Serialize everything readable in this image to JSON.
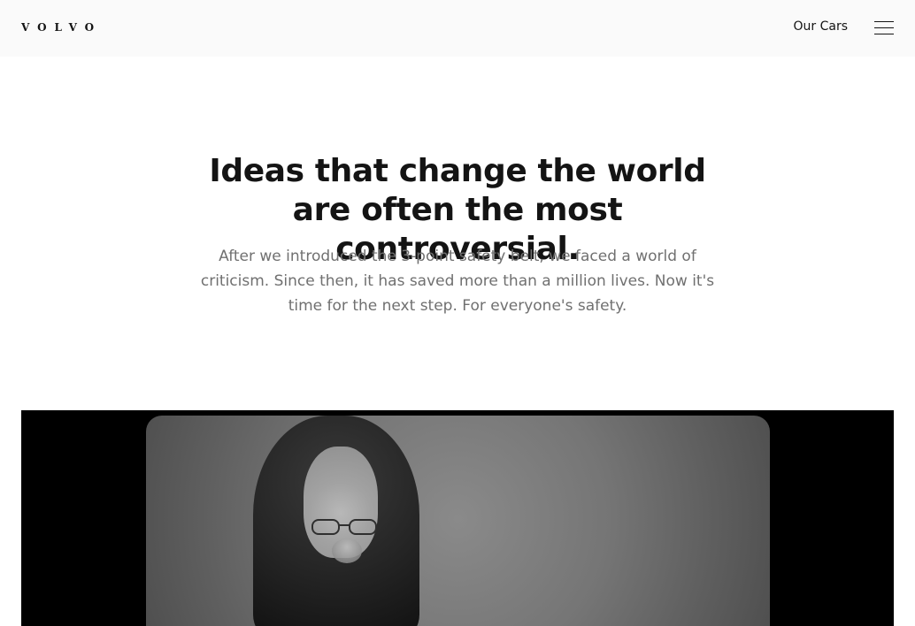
{
  "header": {
    "brand": "VOLVO",
    "nav_link": "Our Cars"
  },
  "hero": {
    "headline": "Ideas that change the world are often the most controversial.",
    "body": "After we introduced the 3-point safety belt, we faced a world of criticism. Since then, it has saved more than a million lives. Now it's time for the next step. For everyone's safety."
  },
  "colors": {
    "header_bg": "#fafafa",
    "text_primary": "#141414",
    "text_secondary": "#707070",
    "video_bg": "#000000"
  }
}
